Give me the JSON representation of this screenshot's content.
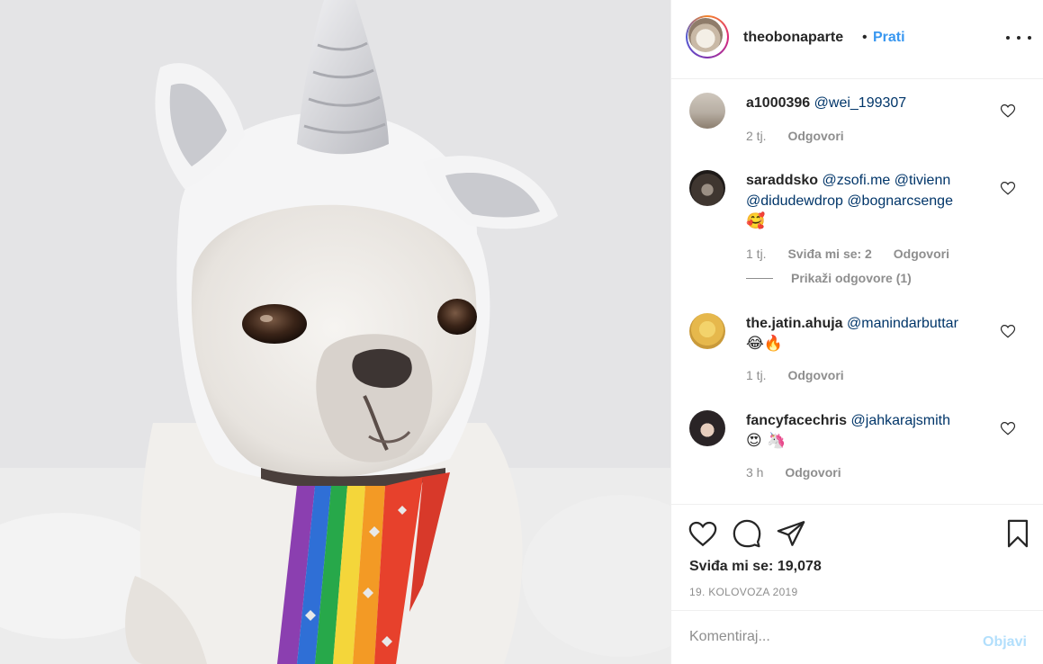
{
  "post": {
    "owner_username": "theobonaparte",
    "separator": "•",
    "follow_label": "Prati",
    "more_icon": "more-options-icon"
  },
  "comments": [
    {
      "username": "a1000396",
      "mentions": "@wei_199307",
      "emoji": "",
      "time": "2 tj.",
      "likes": "",
      "reply_label": "Odgovori"
    },
    {
      "username": "saraddsko",
      "mentions": "@zsofi.me @tivienn @didudewdrop @bognarcsenge",
      "emoji": "🥰",
      "time": "1 tj.",
      "likes": "Sviđa mi se: 2",
      "reply_label": "Odgovori",
      "view_replies": "Prikaži odgovore (1)"
    },
    {
      "username": "the.jatin.ahuja",
      "mentions": "@manindarbuttar",
      "emoji": "😂🔥",
      "time": "1 tj.",
      "likes": "",
      "reply_label": "Odgovori"
    },
    {
      "username": "fancyfacechris",
      "mentions": "@jahkarajsmith",
      "emoji": "😍 🦄",
      "time": "3 h",
      "likes": "",
      "reply_label": "Odgovori"
    }
  ],
  "actions": {
    "like_count": "Sviđa mi se: 19,078",
    "date": "19. KOLOVOZA 2019",
    "icons": [
      "heart-icon",
      "comment-icon",
      "share-icon",
      "bookmark-icon"
    ]
  },
  "composer": {
    "placeholder": "Komentiraj...",
    "post_label": "Objavi"
  },
  "colors": {
    "link_blue": "#3897f0",
    "mention_blue": "#003569",
    "muted_text": "#8e8e8e",
    "disabled_post": "#b2dffc"
  }
}
